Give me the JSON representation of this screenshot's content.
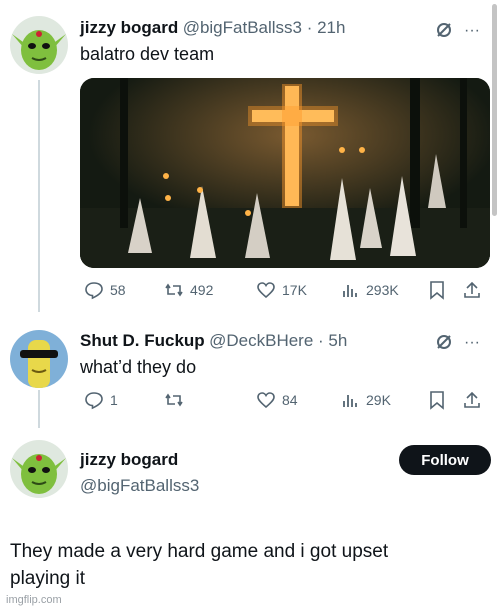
{
  "tweet1": {
    "display_name": "jizzy bogard",
    "handle_time": "@bigFatBallss3 · 21h",
    "text": "balatro dev team",
    "replies": "58",
    "reposts": "492",
    "likes": "17K",
    "views": "293K"
  },
  "tweet2": {
    "display_name": "Shut D. Fuckup",
    "handle_time": "@DeckBHere · 5h",
    "text": "what’d they do",
    "replies": "1",
    "reposts": "",
    "likes": "84",
    "views": "29K"
  },
  "tweet3": {
    "display_name": "jizzy bogard",
    "handle": "@bigFatBallss3",
    "follow_label": "Follow",
    "text_line1": "They made a very hard game and i got upset",
    "text_line2": "playing it"
  },
  "watermark": "imgflip.com",
  "icons": [
    "grok-icon",
    "more-icon",
    "reply-icon",
    "repost-icon",
    "like-icon",
    "views-icon",
    "bookmark-icon",
    "share-icon"
  ],
  "colors": {
    "text": "#0f1419",
    "secondary": "#536471",
    "line": "#cfd9de",
    "follow_bg": "#0f1419"
  }
}
